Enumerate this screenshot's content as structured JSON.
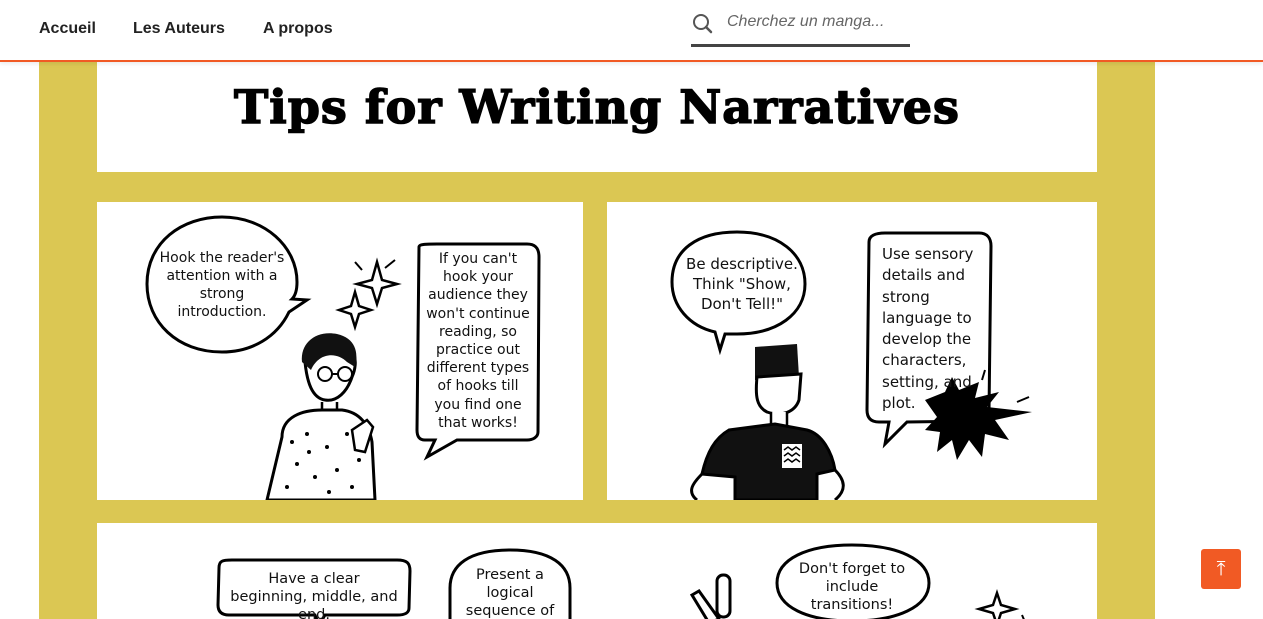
{
  "nav": {
    "items": [
      {
        "label": "Accueil"
      },
      {
        "label": "Les Auteurs"
      },
      {
        "label": "A propos"
      }
    ]
  },
  "search": {
    "placeholder": "Cherchez un manga...",
    "icon": "search-icon"
  },
  "poster": {
    "title": "Tips for Writing Narratives",
    "background_color": "#dbc753",
    "panel1": {
      "bubble_hook": "Hook the reader's attention with a strong introduction.",
      "bubble_practice": "If you can't hook your audience they won't continue reading, so practice out different types of hooks till you find one that works!"
    },
    "panel2": {
      "bubble_descriptive": "Be descriptive. Think \"Show, Don't Tell!\"",
      "bubble_sensory": "Use sensory details and strong language to develop the characters, setting, and plot."
    },
    "panel3": {
      "bubble_structure": "Have a clear beginning, middle, and end.",
      "bubble_logical": "Present a logical sequence of",
      "bubble_transitions": "Don't forget to include transitions!"
    }
  },
  "back_to_top": {
    "icon": "arrow-up-icon",
    "color": "#f15a24"
  },
  "colors": {
    "accent": "#f15a24"
  }
}
